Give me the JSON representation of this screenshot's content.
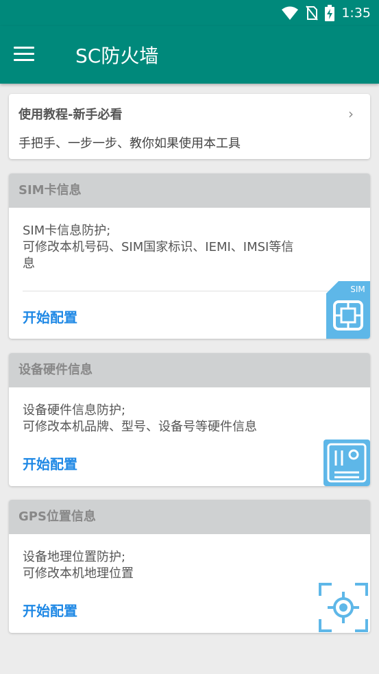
{
  "status_bar": {
    "time": "1:35"
  },
  "app_bar": {
    "title": "SC防火墙"
  },
  "tutorial": {
    "title": "使用教程-新手必看",
    "description": "手把手、一步一步、教你如果使用本工具"
  },
  "sim": {
    "header": "SIM卡信息",
    "desc_line1": "SIM卡信息防护;",
    "desc_line2": "可修改本机号码、SIM国家标识、IEMI、IMSI等信",
    "desc_line3": "息",
    "action": "开始配置",
    "icon_label": "SIM"
  },
  "hardware": {
    "header": "设备硬件信息",
    "desc_line1": "设备硬件信息防护;",
    "desc_line2": "可修改本机品牌、型号、设备号等硬件信息",
    "action": "开始配置"
  },
  "gps": {
    "header": "GPS位置信息",
    "desc_line1": "设备地理位置防护;",
    "desc_line2": "可修改本机地理位置",
    "action": "开始配置"
  },
  "colors": {
    "primary": "#00897b",
    "accent": "#1e88e5",
    "icon_blue": "#5eb7e8"
  }
}
